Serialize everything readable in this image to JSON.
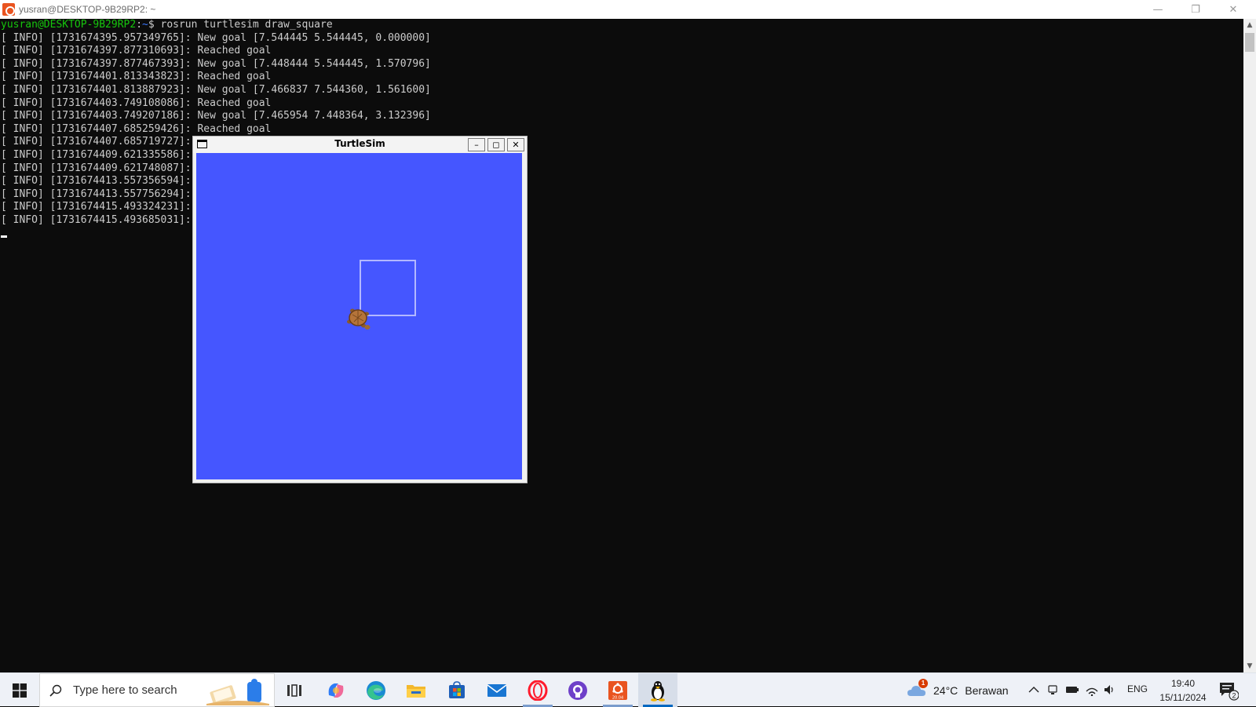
{
  "terminal": {
    "title": "yusran@DESKTOP-9B29RP2: ~",
    "prompt_user": "yusran@DESKTOP-9B29RP2",
    "prompt_sep": ":",
    "prompt_path": "~",
    "prompt_end": "$ ",
    "command": "rosrun turtlesim draw_square",
    "log_lines": [
      "[ INFO] [1731674395.957349765]: New goal [7.544445 5.544445, 0.000000]",
      "[ INFO] [1731674397.877310693]: Reached goal",
      "[ INFO] [1731674397.877467393]: New goal [7.448444 5.544445, 1.570796]",
      "[ INFO] [1731674401.813343823]: Reached goal",
      "[ INFO] [1731674401.813887923]: New goal [7.466837 7.544360, 1.561600]",
      "[ INFO] [1731674403.749108086]: Reached goal",
      "[ INFO] [1731674403.749207186]: New goal [7.465954 7.448364, 3.132396]",
      "[ INFO] [1731674407.685259426]: Reached goal",
      "[ INFO] [1731674407.685719727]: N",
      "[ INFO] [1731674409.621335586]: R",
      "[ INFO] [1731674409.621748087]: N",
      "[ INFO] [1731674413.557356594]: R",
      "[ INFO] [1731674413.557756294]: N",
      "[ INFO] [1731674415.493324231]: R",
      "[ INFO] [1731674415.493685031]: N"
    ]
  },
  "turtlesim": {
    "title": "TurtleSim",
    "background": "#4556ff",
    "pen_color": "#b3b8ff"
  },
  "taskbar": {
    "search_placeholder": "Type here to search",
    "apps": [
      {
        "name": "task-view",
        "icon": "task-view-icon"
      },
      {
        "name": "copilot",
        "icon": "copilot-icon"
      },
      {
        "name": "edge",
        "icon": "edge-icon"
      },
      {
        "name": "file-explorer",
        "icon": "folder-icon"
      },
      {
        "name": "microsoft-store",
        "icon": "store-icon"
      },
      {
        "name": "mail",
        "icon": "mail-icon"
      },
      {
        "name": "opera",
        "icon": "opera-icon"
      },
      {
        "name": "github-desktop",
        "icon": "github-icon"
      },
      {
        "name": "ubuntu",
        "icon": "ubuntu-icon"
      },
      {
        "name": "linux-xserver",
        "icon": "tux-icon"
      }
    ],
    "ubuntu_label": "20.04",
    "weather": {
      "temp": "24°C",
      "condition": "Berawan",
      "badge": "1"
    },
    "language": "ENG",
    "time": "19:40",
    "date": "15/11/2024",
    "notification_count": "2"
  }
}
